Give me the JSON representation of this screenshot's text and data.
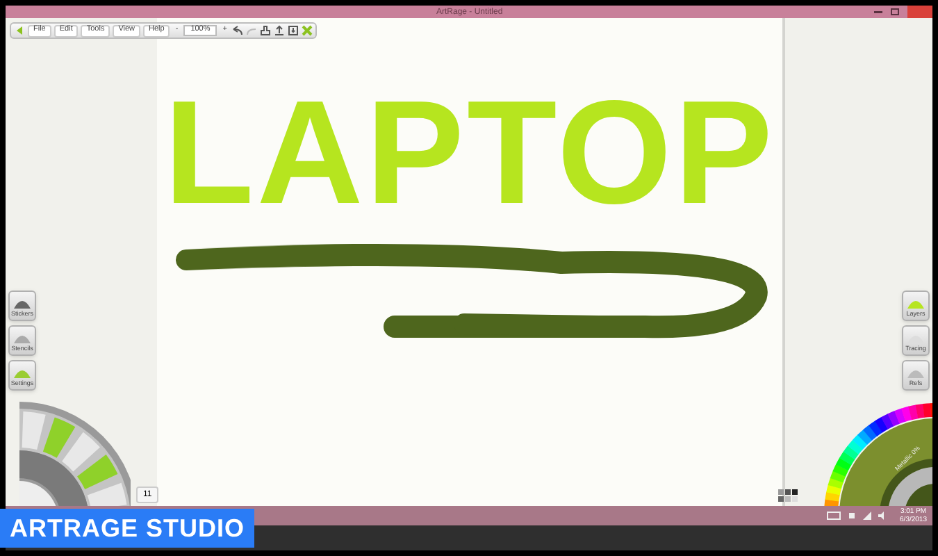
{
  "window": {
    "title": "ArtRage - Untitled"
  },
  "toolbar": {
    "menus": [
      "File",
      "Edit",
      "Tools",
      "View",
      "Help"
    ],
    "zoom_out": "-",
    "zoom": "100%",
    "zoom_in": "+"
  },
  "canvas": {
    "painted_text": "LAPTOP"
  },
  "left_panels": [
    "Stickers",
    "Stencils",
    "Settings"
  ],
  "right_panels": [
    "Layers",
    "Tracing",
    "Refs"
  ],
  "brush_size": "11",
  "color_picker": {
    "label": "Metallic 0%"
  },
  "taskbar": {
    "time": "3:01 PM",
    "date": "6/3/2013"
  },
  "caption": "ARTRAGE STUDIO"
}
